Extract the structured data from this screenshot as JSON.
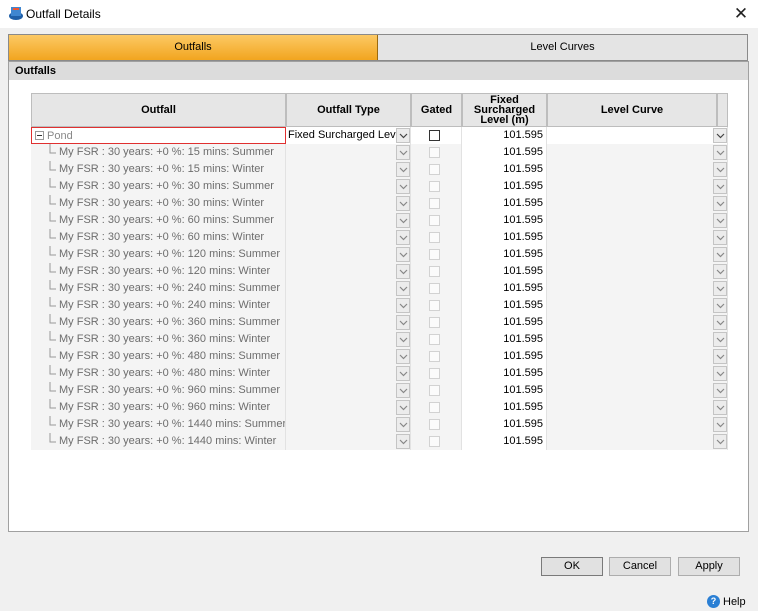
{
  "window": {
    "title": "Outfall Details",
    "close_glyph": "✕",
    "icon": "app-icon"
  },
  "tabs": [
    {
      "label": "Outfalls",
      "active": true
    },
    {
      "label": "Level Curves",
      "active": false
    }
  ],
  "section": {
    "title": "Outfalls"
  },
  "grid": {
    "columns": {
      "outfall": "Outfall",
      "type": "Outfall Type",
      "gated": "Gated",
      "level": "Fixed Surcharged Level (m)",
      "curve": "Level Curve"
    },
    "parent": {
      "name": "Pond",
      "type": "Fixed Surcharged Level",
      "gated": false,
      "level": "101.595",
      "curve": ""
    },
    "children": [
      {
        "name": "My FSR : 30 years: +0 %: 15 mins: Summer",
        "level": "101.595"
      },
      {
        "name": "My FSR : 30 years: +0 %: 15 mins: Winter",
        "level": "101.595"
      },
      {
        "name": "My FSR : 30 years: +0 %: 30 mins: Summer",
        "level": "101.595"
      },
      {
        "name": "My FSR : 30 years: +0 %: 30 mins: Winter",
        "level": "101.595"
      },
      {
        "name": "My FSR : 30 years: +0 %: 60 mins: Summer",
        "level": "101.595"
      },
      {
        "name": "My FSR : 30 years: +0 %: 60 mins: Winter",
        "level": "101.595"
      },
      {
        "name": "My FSR : 30 years: +0 %: 120 mins: Summer",
        "level": "101.595"
      },
      {
        "name": "My FSR : 30 years: +0 %: 120 mins: Winter",
        "level": "101.595"
      },
      {
        "name": "My FSR : 30 years: +0 %: 240 mins: Summer",
        "level": "101.595"
      },
      {
        "name": "My FSR : 30 years: +0 %: 240 mins: Winter",
        "level": "101.595"
      },
      {
        "name": "My FSR : 30 years: +0 %: 360 mins: Summer",
        "level": "101.595"
      },
      {
        "name": "My FSR : 30 years: +0 %: 360 mins: Winter",
        "level": "101.595"
      },
      {
        "name": "My FSR : 30 years: +0 %: 480 mins: Summer",
        "level": "101.595"
      },
      {
        "name": "My FSR : 30 years: +0 %: 480 mins: Winter",
        "level": "101.595"
      },
      {
        "name": "My FSR : 30 years: +0 %: 960 mins: Summer",
        "level": "101.595"
      },
      {
        "name": "My FSR : 30 years: +0 %: 960 mins: Winter",
        "level": "101.595"
      },
      {
        "name": "My FSR : 30 years: +0 %: 1440 mins: Summer",
        "level": "101.595"
      },
      {
        "name": "My FSR : 30 years: +0 %: 1440 mins: Winter",
        "level": "101.595"
      }
    ]
  },
  "buttons": {
    "ok": "OK",
    "cancel": "Cancel",
    "apply": "Apply"
  },
  "help": {
    "label": "Help",
    "glyph": "?"
  },
  "colors": {
    "active_tab": "#f5b334",
    "selection_border": "#e03030",
    "help_icon": "#2a7fd4"
  }
}
